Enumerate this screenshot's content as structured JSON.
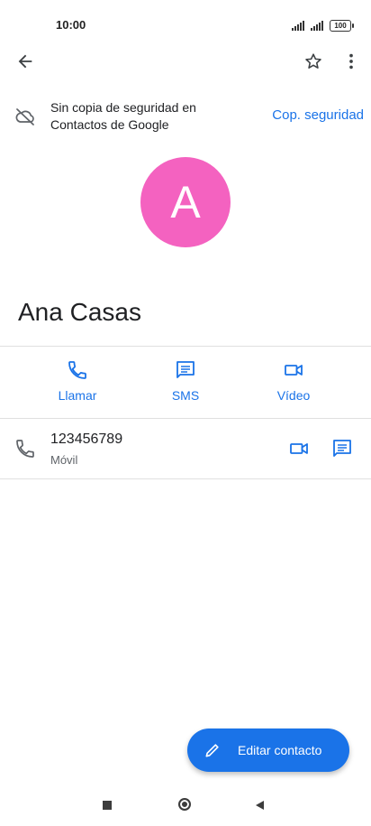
{
  "status_bar": {
    "time": "10:00",
    "battery": "100"
  },
  "backup": {
    "line1": "Sin copia de seguridad en",
    "line2": "Contactos de Google",
    "action": "Cop. seguridad"
  },
  "contact": {
    "initial": "A",
    "name": "Ana Casas",
    "avatar_color": "#f462c0"
  },
  "actions": [
    {
      "label": "Llamar",
      "icon": "phone-icon"
    },
    {
      "label": "SMS",
      "icon": "message-icon"
    },
    {
      "label": "Vídeo",
      "icon": "video-icon"
    }
  ],
  "phone": {
    "number": "123456789",
    "type": "Móvil"
  },
  "fab": {
    "label": "Editar contacto",
    "icon": "pencil-icon"
  },
  "colors": {
    "accent": "#1a73e8"
  }
}
